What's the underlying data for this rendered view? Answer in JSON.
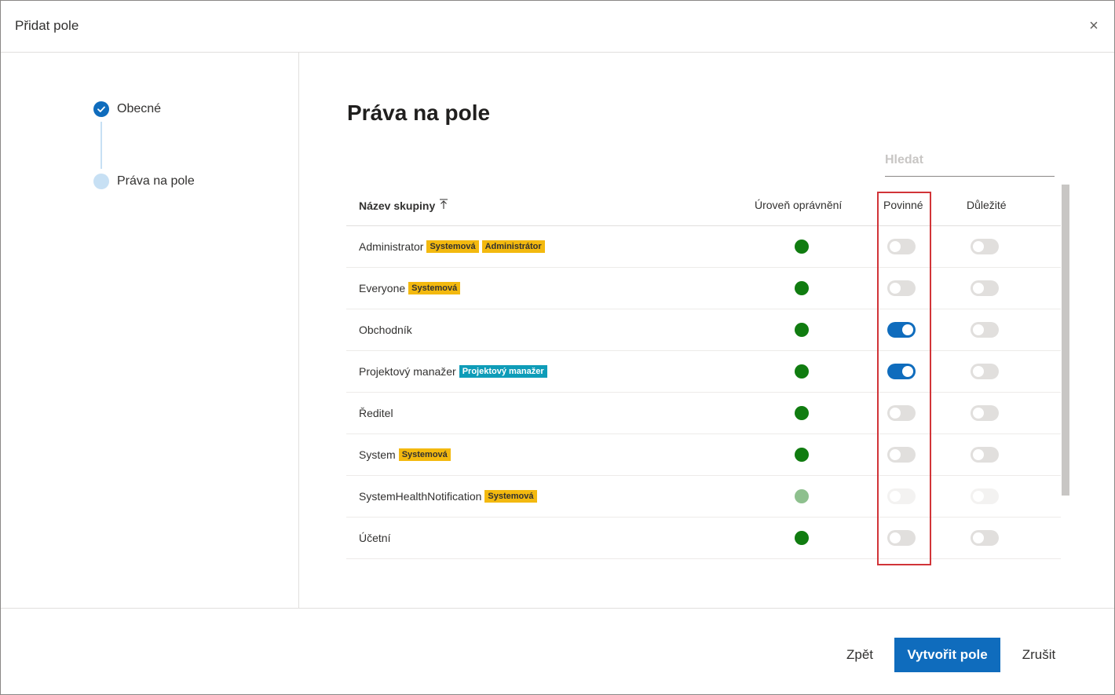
{
  "dialog": {
    "title": "Přidat pole",
    "close_symbol": "×"
  },
  "steps": [
    {
      "label": "Obecné",
      "state": "done",
      "icon": "checkmark-icon"
    },
    {
      "label": "Práva na pole",
      "state": "current",
      "icon": "circle-icon"
    }
  ],
  "main": {
    "title": "Práva na pole",
    "search_placeholder": "Hledat"
  },
  "table": {
    "columns": {
      "name": "Název skupiny",
      "level": "Úroveň oprávnění",
      "required": "Povinné",
      "important": "Důležité"
    },
    "sort_icon": "sort-ascending-icon",
    "rows": [
      {
        "name": "Administrator",
        "tags": [
          "Systemová",
          "Administrátor"
        ],
        "required": false,
        "important": false,
        "disabled": false
      },
      {
        "name": "Everyone",
        "tags": [
          "Systemová"
        ],
        "required": false,
        "important": false,
        "disabled": false
      },
      {
        "name": "Obchodník",
        "tags": [],
        "required": true,
        "important": false,
        "disabled": false
      },
      {
        "name": "Projektový manažer",
        "tags": [
          "Projektový manažer"
        ],
        "required": true,
        "important": false,
        "disabled": false
      },
      {
        "name": "Ředitel",
        "tags": [],
        "required": false,
        "important": false,
        "disabled": false
      },
      {
        "name": "System",
        "tags": [
          "Systemová"
        ],
        "required": false,
        "important": false,
        "disabled": false
      },
      {
        "name": "SystemHealthNotification",
        "tags": [
          "Systemová"
        ],
        "required": false,
        "important": false,
        "disabled": true
      },
      {
        "name": "Účetní",
        "tags": [],
        "required": false,
        "important": false,
        "disabled": false
      }
    ]
  },
  "footer": {
    "back_label": "Zpět",
    "create_label": "Vytvořit pole",
    "cancel_label": "Zrušit"
  },
  "colors": {
    "accent": "#0f6cbd",
    "permission_dot": "#107c10",
    "tag_yellow": "#f3b90f",
    "tag_teal": "#0e9cb8",
    "highlight_border": "#d13438"
  }
}
